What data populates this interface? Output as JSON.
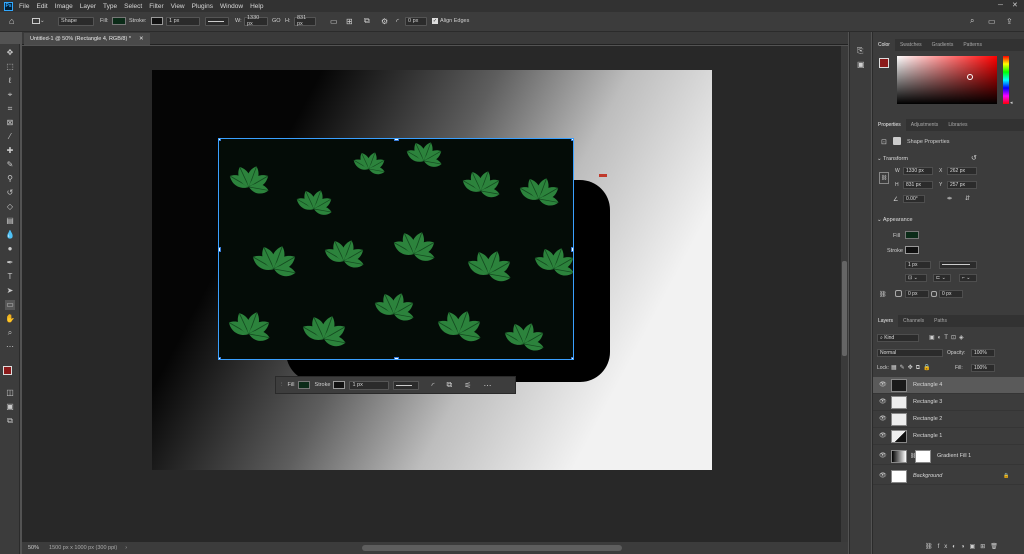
{
  "app": {
    "logo": "Ps"
  },
  "menu": [
    "File",
    "Edit",
    "Image",
    "Layer",
    "Type",
    "Select",
    "Filter",
    "View",
    "Plugins",
    "Window",
    "Help"
  ],
  "options": {
    "tool_mode": "Shape",
    "fill_label": "Fill:",
    "stroke_label": "Stroke:",
    "stroke_width": "1 px",
    "w_label": "W:",
    "w_value": "1330 px",
    "go_label": "GO",
    "h_label": "H:",
    "h_value": "831 px",
    "radius_value": "0 px",
    "align_edges": "Align Edges"
  },
  "document": {
    "tab_title": "Untitled-1 @ 50% (Rectangle 4, RGB/8) *"
  },
  "contextual_bar": {
    "fill": "Fill",
    "stroke": "Stroke",
    "stroke_width": "1 px"
  },
  "status": {
    "zoom": "50%",
    "doc_info": "1500 px x 1000 px (300 ppi)"
  },
  "color_panel": {
    "tabs": [
      "Color",
      "Swatches",
      "Gradients",
      "Patterns"
    ],
    "foreground": "#8b1a1a"
  },
  "properties": {
    "tabs": [
      "Properties",
      "Adjustments",
      "Libraries"
    ],
    "kind": "Shape Properties",
    "transform_label": "Transform",
    "w": "1330 px",
    "x": "262 px",
    "h": "831 px",
    "y": "257 px",
    "angle": "0.00°",
    "appearance_label": "Appearance",
    "fill_label": "Fill",
    "stroke_label": "Stroke",
    "stroke_width": "1 px",
    "radius_a": "0 px",
    "radius_b": "0 px"
  },
  "layers_panel": {
    "tabs": [
      "Layers",
      "Channels",
      "Paths"
    ],
    "kind": "Kind",
    "blend_mode": "Normal",
    "opacity_label": "Opacity:",
    "opacity": "100%",
    "lock_label": "Lock:",
    "fill_label": "Fill:",
    "fill": "100%",
    "layers": [
      {
        "name": "Rectangle 4"
      },
      {
        "name": "Rectangle 3"
      },
      {
        "name": "Rectangle 2"
      },
      {
        "name": "Rectangle 1"
      },
      {
        "name": "Gradient Fill 1"
      },
      {
        "name": "Background"
      }
    ]
  },
  "colors": {
    "accent": "#31a8ff",
    "selection": "#3aa0ff"
  }
}
